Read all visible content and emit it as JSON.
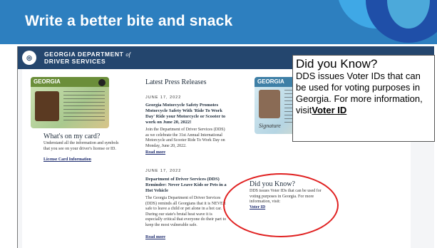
{
  "slide": {
    "title": "Write a better bite and snack"
  },
  "dds": {
    "name_line1": "GEORGIA DEPARTMENT",
    "name_of": "of",
    "name_line2": "DRIVER SERVICES"
  },
  "left": {
    "card_state": "GEORGIA",
    "heading": "What's on my card?",
    "body": "Understand all the information and symbols that you see on your driver's license or ID.",
    "link": "License Card Information"
  },
  "press": {
    "heading": "Latest Press Releases",
    "items": [
      {
        "date": "JUNE 17, 2022",
        "title": "Georgia Motorcycle Safety Promotes Motorcycle Safety With 'Ride To Work Day' Ride your Motorcycle or Scooter to work on June 20, 2022!",
        "body": "Join the Department of Driver Services (DDS) as we celebrate the 31st Annual International Motorcycle and Scooter Ride To Work Day on Monday, June 20, 2022.",
        "link": "Read more"
      },
      {
        "date": "JUNE 17, 2022",
        "title": "Department of Driver Services (DDS) Reminder: Never Leave Kids or Pets in a Hot Vehicle",
        "body": "The Georgia Department of Driver Services (DDS) reminds all Georgians that it is NEVER safe to leave a child or pet alone in a hot car. During our state's brutal heat wave it is especially critical that everyone do their part to keep the most vulnerable safe.",
        "link": "Read more"
      }
    ]
  },
  "right": {
    "card_state": "GEORGIA",
    "signature": "Signature",
    "heading": "Did you Know?",
    "body": "DDS issues Voter IDs that can be used for voting purposes in Georgia. For more information, visit:",
    "link": "Voter ID"
  },
  "callout": {
    "title": "Did you Know?",
    "body": "DDS issues Voter IDs that can be used for voting purposes in Georgia. For more information, visit",
    "link": "Voter ID"
  },
  "colors": {
    "header_bg": "#2d7fbf",
    "dds_bar": "#24466e",
    "highlight_circle": "#e02020"
  }
}
